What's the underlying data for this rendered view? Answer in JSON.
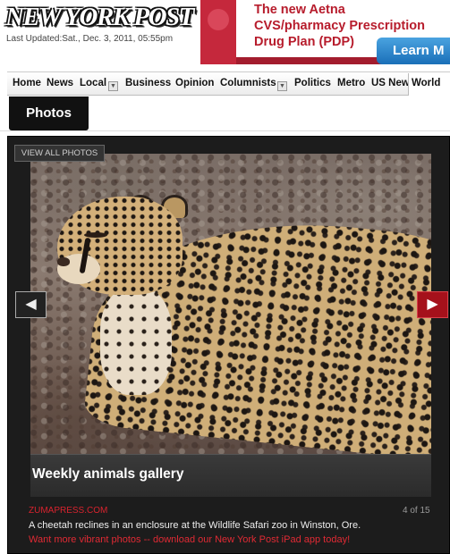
{
  "header": {
    "logo_text": "NEW YORK POST",
    "last_updated": "Last Updated:Sat., Dec. 3, 2011, 05:55pm"
  },
  "ad": {
    "text": "The new Aetna\nCVS/pharmacy Prescription\nDrug Plan (PDP)",
    "button_label": "Learn M"
  },
  "nav": {
    "items": [
      {
        "label": "Home"
      },
      {
        "label": "News"
      },
      {
        "label": "Local",
        "dropdown": true
      },
      {
        "label": "Business"
      },
      {
        "label": "Opinion"
      },
      {
        "label": "Columnists",
        "dropdown": true
      },
      {
        "label": "Politics"
      },
      {
        "label": "Metro"
      },
      {
        "label": "US News"
      },
      {
        "label": "World"
      }
    ]
  },
  "section_tab": "Photos",
  "gallery": {
    "view_all_label": "VIEW ALL PHOTOS",
    "title": "Weekly animals gallery",
    "credit": "ZUMAPRESS.COM",
    "counter": "4 of 15",
    "description": "A cheetah reclines in an enclosure at the Wildlife Safari zoo in Winston, Ore.",
    "promo": "Want more vibrant photos -- download our New York Post iPad app today!",
    "prev_icon": "◀",
    "next_icon": "▶",
    "colors": {
      "accent_red": "#a5111b",
      "promo_red": "#e02a34",
      "background": "#1c1c1c"
    }
  }
}
